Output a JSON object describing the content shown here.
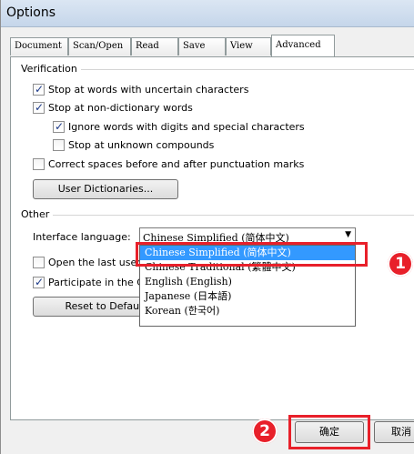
{
  "window": {
    "title": "Options"
  },
  "tabs": [
    {
      "label": "Document"
    },
    {
      "label": "Scan/Open"
    },
    {
      "label": "Read"
    },
    {
      "label": "Save"
    },
    {
      "label": "View"
    },
    {
      "label": "Advanced",
      "active": true
    }
  ],
  "verification": {
    "title": "Verification",
    "items": [
      {
        "label": "Stop at words with uncertain characters",
        "checked": true
      },
      {
        "label": "Stop at non-dictionary words",
        "checked": true
      },
      {
        "label": "Ignore words with digits and special characters",
        "checked": true
      },
      {
        "label": "Stop at unknown compounds",
        "checked": false
      },
      {
        "label": "Correct spaces before and after punctuation marks",
        "checked": false
      }
    ],
    "user_dictionaries_button": "User Dictionaries..."
  },
  "other": {
    "title": "Other",
    "interface_language_label": "Interface language:",
    "interface_language_value": "Chinese Simplified (简体中文)",
    "language_options": [
      "Chinese Simplified (简体中文)",
      "Chinese Traditional (繁體中文)",
      "English (English)",
      "Japanese (日本語)",
      "Korean (한국어)"
    ],
    "open_last_used_label": "Open the last used",
    "open_last_used_checked": false,
    "participate_label": "Participate in the Cu",
    "participate_checked": true,
    "reset_button": "Reset to Default"
  },
  "annotations": {
    "marker1": "1",
    "marker2": "2"
  },
  "buttons": {
    "ok": "确定",
    "cancel": "取消"
  },
  "colors": {
    "highlight": "#e8202a",
    "selection": "#3399ff"
  }
}
